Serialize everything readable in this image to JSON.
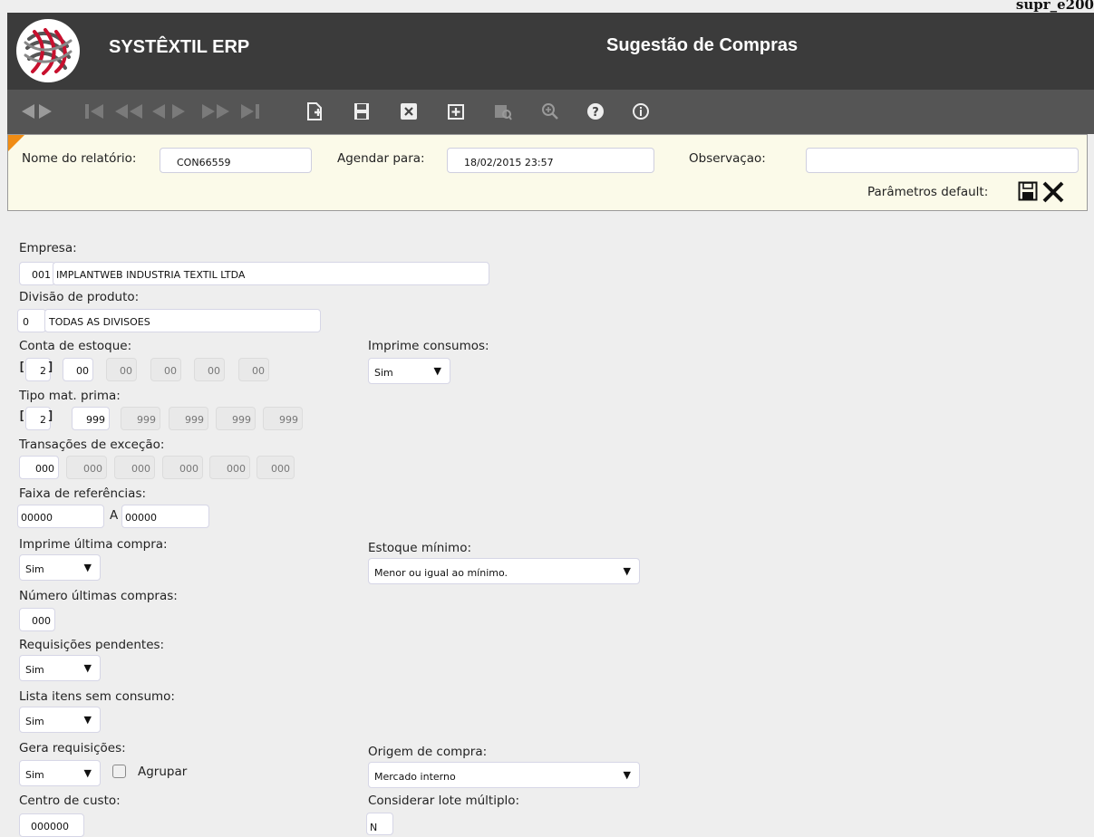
{
  "screen_id": "supr_e200",
  "app_name": "SYSTÊXTIL ERP",
  "page_title": "Sugestão de Compras",
  "toolbar": {
    "icons": [
      "prev-record-icon",
      "next-record-icon",
      "first-icon",
      "rewind-icon",
      "back-icon",
      "forward-icon",
      "fast-forward-icon",
      "last-icon",
      "new-icon",
      "save-icon",
      "delete-icon",
      "add-icon",
      "preview-icon",
      "zoom-icon",
      "help-icon",
      "info-icon"
    ]
  },
  "report_params": {
    "name_label": "Nome do relatório:",
    "name_value": "CON66559",
    "schedule_label": "Agendar para:",
    "schedule_value": "18/02/2015 23:57",
    "observation_label": "Observaçao:",
    "observation_value": "",
    "defaults_label": "Parâmetros default:"
  },
  "form": {
    "empresa": {
      "label": "Empresa:",
      "code": "001",
      "name": "IMPLANTWEB INDUSTRIA TEXTIL LTDA"
    },
    "divisao": {
      "label": "Divisão de produto:",
      "code": "0",
      "name": "TODAS AS DIVISOES"
    },
    "conta": {
      "label": "Conta de estoque:",
      "bracket_open": "[",
      "count": "2",
      "bracket_close": "]",
      "values": [
        "00",
        "00",
        "00",
        "00",
        "00"
      ]
    },
    "tipo": {
      "label": "Tipo mat. prima:",
      "bracket_open": "[",
      "count": "2",
      "bracket_close": "]",
      "values": [
        "999",
        "999",
        "999",
        "999",
        "999"
      ]
    },
    "transacoes": {
      "label": "Transações de exceção:",
      "values": [
        "000",
        "000",
        "000",
        "000",
        "000",
        "000"
      ]
    },
    "faixa": {
      "label": "Faixa de referências:",
      "from": "00000",
      "sep": "A",
      "to": "00000"
    },
    "imprime_ultima": {
      "label": "Imprime última compra:",
      "value": "Sim"
    },
    "numero_ultimas": {
      "label": "Número últimas compras:",
      "value": "000"
    },
    "requisicoes": {
      "label": "Requisições pendentes:",
      "value": "Sim"
    },
    "lista_itens": {
      "label": "Lista itens sem consumo:",
      "value": "Sim"
    },
    "gera_req": {
      "label": "Gera requisições:",
      "value": "Sim",
      "agrupar_label": "Agrupar"
    },
    "centro_custo": {
      "label": "Centro de custo:",
      "value": "000000"
    },
    "imprime_consumos": {
      "label": "Imprime consumos:",
      "value": "Sim"
    },
    "estoque_minimo": {
      "label": "Estoque mínimo:",
      "value": "Menor ou igual ao mínimo."
    },
    "origem": {
      "label": "Origem de compra:",
      "value": "Mercado interno"
    },
    "lote_multiplo": {
      "label": "Considerar lote múltiplo:",
      "value": "N"
    }
  },
  "colors": {
    "header_bg": "#3b3b3b",
    "toolbar_bg": "#555555",
    "params_bg": "#fbfae9",
    "accent": "#f08c14",
    "page_bg": "#eeeeee"
  }
}
